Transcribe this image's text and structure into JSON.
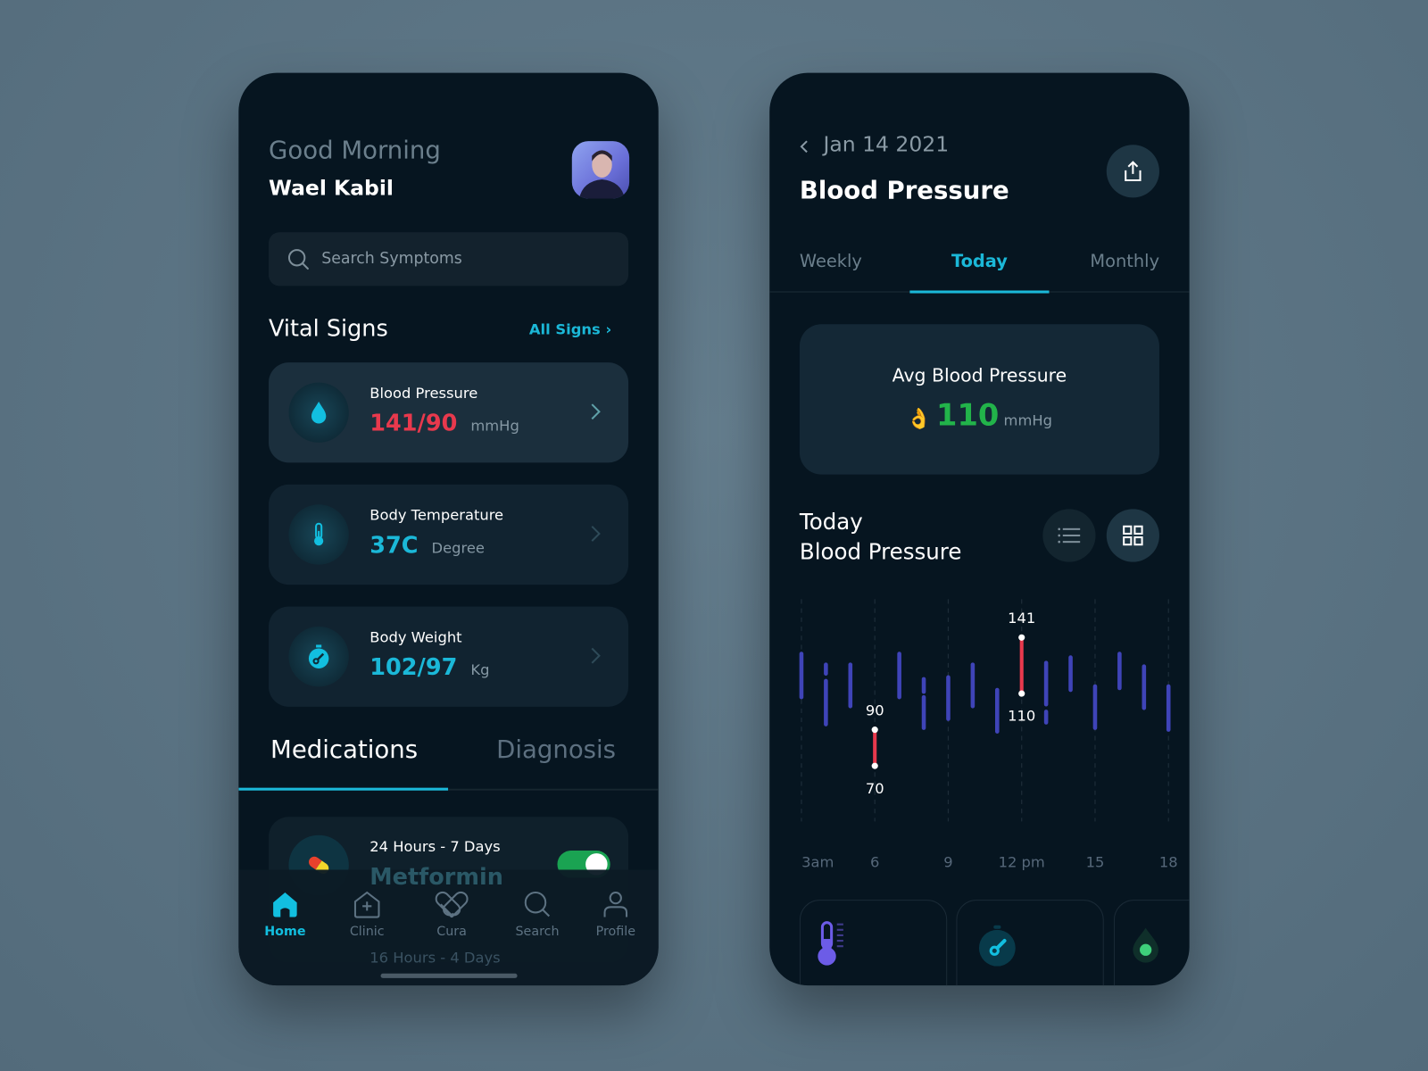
{
  "colors": {
    "background": "#5b7383",
    "phone": "#061520",
    "accent": "#1bb8d8",
    "danger": "#e8394d",
    "success": "#22b34a",
    "bar": "#3f44b8"
  },
  "home": {
    "greeting": "Good Morning",
    "user_name": "Wael Kabil",
    "search": {
      "placeholder": "Search Symptoms",
      "icon": "search-icon"
    },
    "vitals": {
      "title": "Vital Signs",
      "all_link": "All Signs",
      "items": [
        {
          "label": "Blood Pressure",
          "value": "141/90",
          "unit": "mmHg",
          "icon": "drop-icon",
          "color": "#e8394d"
        },
        {
          "label": "Body Temperature",
          "value": "37C",
          "unit": "Degree",
          "icon": "thermometer-icon",
          "color": "#1bb8d8"
        },
        {
          "label": "Body Weight",
          "value": "102/97",
          "unit": "Kg",
          "icon": "stopwatch-icon",
          "color": "#1bb8d8"
        }
      ]
    },
    "tabs": [
      {
        "label": "Medications",
        "active": true
      },
      {
        "label": "Diagnosis",
        "active": false
      }
    ],
    "medications": [
      {
        "schedule": "24 Hours - 7 Days",
        "name": "Metformin",
        "enabled": true
      },
      {
        "schedule": "16 Hours - 4 Days"
      }
    ],
    "nav": [
      {
        "label": "Home",
        "icon": "home-icon",
        "active": true
      },
      {
        "label": "Clinic",
        "icon": "clinic-icon"
      },
      {
        "label": "Cura",
        "icon": "cura-icon"
      },
      {
        "label": "Search",
        "icon": "search-icon"
      },
      {
        "label": "Profile",
        "icon": "profile-icon"
      }
    ]
  },
  "detail": {
    "date": "Jan 14 2021",
    "title": "Blood Pressure",
    "tabs": [
      {
        "label": "Weekly"
      },
      {
        "label": "Today",
        "active": true
      },
      {
        "label": "Monthly"
      }
    ],
    "avg": {
      "label": "Avg Blood Pressure",
      "emoji": "👌",
      "value": "110",
      "unit": "mmHg"
    },
    "section_title_1": "Today",
    "section_title_2": "Blood Pressure",
    "bottom_cards": [
      {
        "icon": "thermometer-icon"
      },
      {
        "icon": "stopwatch-icon"
      },
      {
        "icon": "drop-icon"
      }
    ]
  },
  "chart_data": {
    "type": "range-bar",
    "x_unit": "hour",
    "tick_labels": [
      "3am",
      "6",
      "9",
      "12 pm",
      "15",
      "18"
    ],
    "tick_hours": [
      3,
      6,
      9,
      12,
      15,
      18
    ],
    "grid": "vertical dashed",
    "series": [
      {
        "hour": 3,
        "low": 108,
        "high": 132
      },
      {
        "hour": 4,
        "low": 93,
        "high": 126,
        "gap": [
          117,
          121
        ]
      },
      {
        "hour": 5,
        "low": 103,
        "high": 126
      },
      {
        "hour": 6,
        "low": 70,
        "high": 90,
        "highlight": true,
        "low_label": "70",
        "high_label": "90"
      },
      {
        "hour": 7,
        "low": 108,
        "high": 132
      },
      {
        "hour": 8,
        "low": 91,
        "high": 118,
        "gap": [
          108,
          111
        ]
      },
      {
        "hour": 9,
        "low": 96,
        "high": 119
      },
      {
        "hour": 10,
        "low": 103,
        "high": 126
      },
      {
        "hour": 11,
        "low": 89,
        "high": 112
      },
      {
        "hour": 12,
        "low": 110,
        "high": 141,
        "highlight": true,
        "low_label": "110",
        "high_label": "141"
      },
      {
        "hour": 13,
        "low": 94,
        "high": 127,
        "gap": [
          100,
          104
        ]
      },
      {
        "hour": 14,
        "low": 112,
        "high": 130
      },
      {
        "hour": 15,
        "low": 91,
        "high": 114
      },
      {
        "hour": 16,
        "low": 113,
        "high": 132
      },
      {
        "hour": 17,
        "low": 102,
        "high": 125
      },
      {
        "hour": 18,
        "low": 90,
        "high": 114
      }
    ]
  }
}
